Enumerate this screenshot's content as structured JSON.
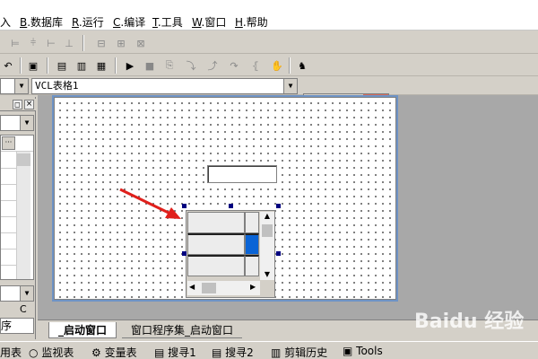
{
  "menu": [
    {
      "label": "入",
      "key": ""
    },
    {
      "label": ".数据库",
      "key": "B"
    },
    {
      "label": ".运行",
      "key": "R"
    },
    {
      "label": ".编译",
      "key": "C"
    },
    {
      "label": ".工具",
      "key": "T"
    },
    {
      "label": ".窗口",
      "key": "W"
    },
    {
      "label": ".帮助",
      "key": "H"
    }
  ],
  "combo_left": {
    "value": ""
  },
  "combo_component": {
    "value": "VCL表格1"
  },
  "left_panel": {
    "label_c": "C",
    "label_seq": "序"
  },
  "tabs": [
    {
      "label": "_启动窗口",
      "active": true
    },
    {
      "label": "窗口程序集_启动窗口",
      "active": false
    }
  ],
  "status_items": [
    {
      "label": "用表"
    },
    {
      "label": "监视表"
    },
    {
      "label": "变量表"
    },
    {
      "label": "搜寻1"
    },
    {
      "label": "搜寻2"
    },
    {
      "label": "剪辑历史"
    },
    {
      "label": "Tools"
    }
  ],
  "watermark": "Baidu 经验",
  "colors": {
    "arrow": "#e0201c",
    "selection": "#0a64d6",
    "handle": "#000080"
  }
}
